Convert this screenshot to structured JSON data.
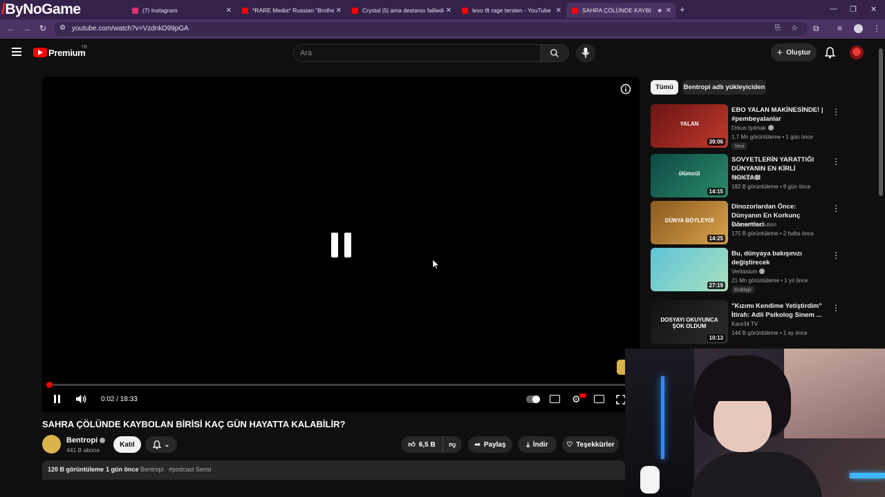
{
  "browser": {
    "brand_logo": "ByNoGame",
    "tabs": [
      {
        "title": "(7) Instagram",
        "fav_color": "#e1306c"
      },
      {
        "title": "*RARE Media* Russian \"Brother",
        "fav_color": "#ff0000"
      },
      {
        "title": "Crystal |5| ama destansı failledi",
        "fav_color": "#ff0000"
      },
      {
        "title": "levo tft rage tersten - YouTube",
        "fav_color": "#ff0000"
      },
      {
        "title": "SAHRA ÇÖLÜNDE KAYBOL",
        "fav_color": "#ff0000"
      }
    ],
    "url": "youtube.com/watch?v=VzdnkD99pGA"
  },
  "youtube": {
    "brand": "Premium",
    "country": "TR",
    "search_placeholder": "Ara",
    "create_label": "Oluştur"
  },
  "player": {
    "time": "0:02 / 18:33",
    "progress_fraction": 0.002
  },
  "video": {
    "title": "SAHRA ÇÖLÜNDE KAYBOLAN BİRİSİ KAÇ GÜN HAYATTA KALABİLİR?",
    "channel": "Bentropi",
    "subscribers": "441 B abone",
    "join_label": "Katıl",
    "likes": "6,5 B",
    "share_label": "Paylaş",
    "download_label": "İndir",
    "thanks_label": "Teşekkürler",
    "views": "120 B görüntüleme",
    "age": "1 gün önce",
    "desc_channel": "Bentropi",
    "hashtag": "#podcast Serisi"
  },
  "sidebar": {
    "chips": [
      "Tümü",
      "Bentropi adlı yükleyiciden"
    ],
    "recs": [
      {
        "title": "EBO YALAN MAKİNESİNDE! | #pembeyalanlar",
        "channel": "Orkun Işıtmak",
        "meta": "1,7 Mn görüntüleme • 1 gün önce",
        "badge": "Yeni",
        "duration": "39:06",
        "verified": true,
        "colors": [
          "#6b1414",
          "#c0392b"
        ],
        "overlay": "YALAN"
      },
      {
        "title": "SOVYETLERİN YARATTIĞI DÜNYANIN EN KİRLİ NOKTASI",
        "channel": "Bentropi",
        "meta": "182 B görüntüleme • 8 gün önce",
        "badge": "",
        "duration": "14:15",
        "verified": true,
        "colors": [
          "#0e4a45",
          "#2a8a6a"
        ],
        "overlay": "ölümcül"
      },
      {
        "title": "Dinozorlardan Önce: Dünyanın En Korkunç Dönemleri",
        "channel": "Xverse Revolution",
        "meta": "175 B görüntüleme • 2 hafta önce",
        "badge": "",
        "duration": "14:25",
        "verified": false,
        "colors": [
          "#8a5a20",
          "#d9a24a"
        ],
        "overlay": "DÜNYA BÖYLEYDİ"
      },
      {
        "title": "Bu, dünyaya bakışınızı değiştirecek",
        "channel": "Veritasium",
        "meta": "21 Mn görüntüleme • 1 yıl önce",
        "badge": "Dublajlı",
        "duration": "27:19",
        "verified": true,
        "colors": [
          "#5ec3d6",
          "#a8e0c0"
        ],
        "overlay": ""
      },
      {
        "title": "\"Kızımı Kendime Yetiştirdim\" İtirafı: Adli Psikolog Sinem ...",
        "channel": "Kare34 TV",
        "meta": "144 B görüntüleme • 1 ay önce",
        "badge": "",
        "duration": "10:13",
        "verified": false,
        "colors": [
          "#111111",
          "#2c2c2c"
        ],
        "overlay": "DOSYAYI OKUYUNCA ŞOK OLDUM"
      }
    ]
  }
}
